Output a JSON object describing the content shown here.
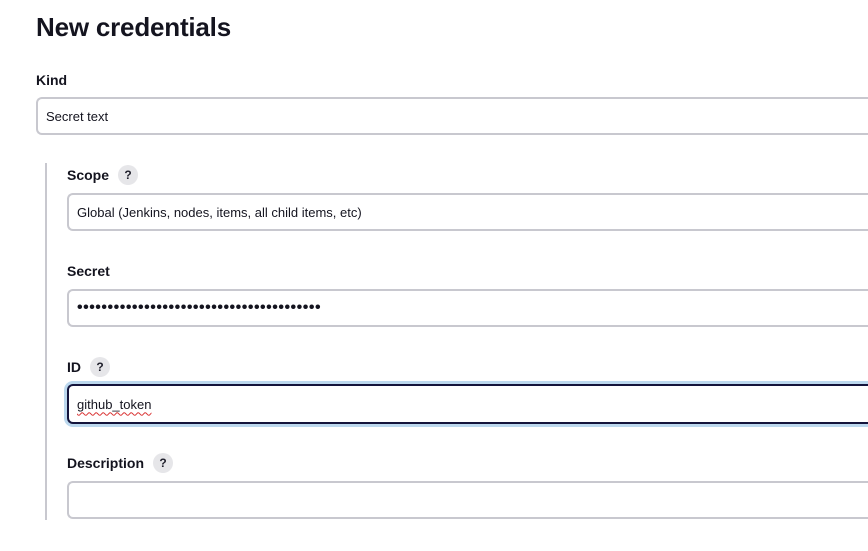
{
  "page": {
    "title": "New credentials"
  },
  "kind": {
    "label": "Kind",
    "value": "Secret text"
  },
  "scope": {
    "label": "Scope",
    "help": "?",
    "value": "Global (Jenkins, nodes, items, all child items, etc)"
  },
  "secret": {
    "label": "Secret",
    "masked_value": "••••••••••••••••••••••••••••••••••••••••"
  },
  "id": {
    "label": "ID",
    "help": "?",
    "value": "github_token"
  },
  "description": {
    "label": "Description",
    "help": "?",
    "value": ""
  },
  "colors": {
    "focus_border": "#14143c",
    "focus_ring": "#bcd8ee",
    "field_border": "#c8c8cf",
    "help_bg": "#e6e6e9"
  }
}
